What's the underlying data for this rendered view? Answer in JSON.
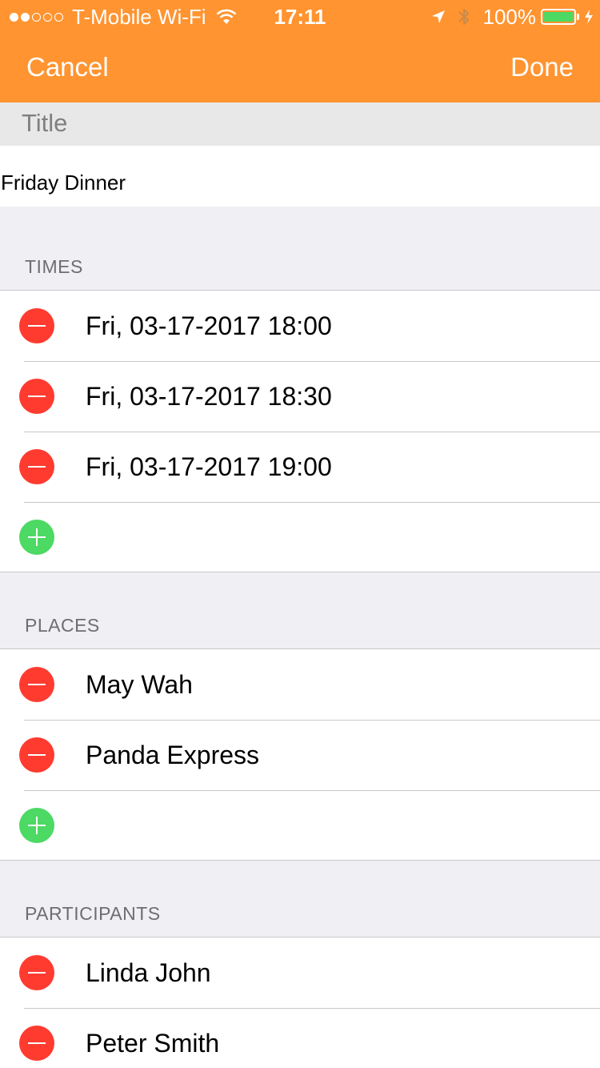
{
  "status_bar": {
    "carrier": "T-Mobile Wi-Fi",
    "time": "17:11",
    "battery": "100%",
    "signal_dots_filled": 2,
    "signal_dots_total": 5
  },
  "nav": {
    "cancel_label": "Cancel",
    "done_label": "Done"
  },
  "title_section": {
    "label": "Title",
    "value": "Friday Dinner"
  },
  "times": {
    "header": "TIMES",
    "items": [
      {
        "label": "Fri, 03-17-2017 18:00"
      },
      {
        "label": "Fri, 03-17-2017 18:30"
      },
      {
        "label": "Fri, 03-17-2017 19:00"
      }
    ]
  },
  "places": {
    "header": "PLACES",
    "items": [
      {
        "label": "May Wah"
      },
      {
        "label": "Panda Express"
      }
    ]
  },
  "participants": {
    "header": "PARTICIPANTS",
    "items": [
      {
        "label": "Linda John"
      },
      {
        "label": "Peter Smith"
      }
    ]
  },
  "icons": {
    "delete": "minus-circle-icon",
    "add": "plus-circle-icon",
    "wifi": "wifi-icon",
    "location": "location-arrow-icon",
    "bluetooth": "bluetooth-icon",
    "charging": "charging-bolt-icon"
  },
  "colors": {
    "nav_bar": "#ff9430",
    "delete": "#ff3b30",
    "add": "#4cd964",
    "battery_fill": "#4cd964",
    "grouped_bg": "#efeff4",
    "section_header_text": "#6d6d72"
  }
}
